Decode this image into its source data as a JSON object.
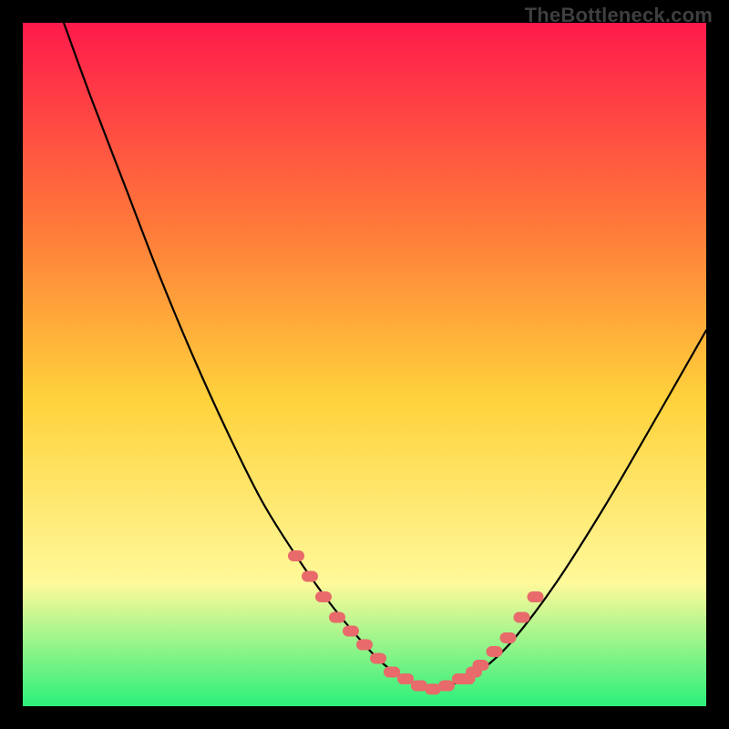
{
  "watermark": "TheBottleneck.com",
  "chart_data": {
    "type": "line",
    "title": "",
    "xlabel": "",
    "ylabel": "",
    "xlim": [
      0,
      100
    ],
    "ylim": [
      0,
      100
    ],
    "grid": false,
    "legend": null,
    "background_gradient": {
      "top": "#ff1a4b",
      "mid_upper": "#ff7a3a",
      "mid": "#ffd23b",
      "mid_lower": "#fff99a",
      "bottom": "#2bf07a"
    },
    "series": [
      {
        "name": "curve",
        "color": "#000000",
        "x": [
          6,
          10,
          15,
          20,
          25,
          30,
          35,
          40,
          45,
          50,
          53,
          56,
          58,
          60,
          62,
          65,
          68,
          72,
          78,
          85,
          92,
          100
        ],
        "y": [
          100,
          89,
          76,
          63,
          51,
          40,
          30,
          22,
          15,
          9,
          6,
          4,
          3,
          2.5,
          3,
          4,
          6,
          10,
          18,
          29,
          41,
          55
        ]
      },
      {
        "name": "highlight-left",
        "color": "#e86a6a",
        "style": "dotted-thick",
        "x": [
          40,
          42,
          44,
          46,
          48,
          50,
          52,
          54,
          56,
          58
        ],
        "y": [
          22,
          19,
          16,
          13,
          11,
          9,
          7,
          5,
          4,
          3
        ]
      },
      {
        "name": "highlight-bottom",
        "color": "#e86a6a",
        "style": "dotted-thick",
        "x": [
          54,
          56,
          58,
          60,
          62,
          64,
          66
        ],
        "y": [
          5,
          4,
          3,
          2.5,
          3,
          4,
          5
        ]
      },
      {
        "name": "highlight-right",
        "color": "#e86a6a",
        "style": "dotted-thick",
        "x": [
          65,
          67,
          69,
          71,
          73,
          75
        ],
        "y": [
          4,
          6,
          8,
          10,
          13,
          16
        ]
      }
    ]
  }
}
